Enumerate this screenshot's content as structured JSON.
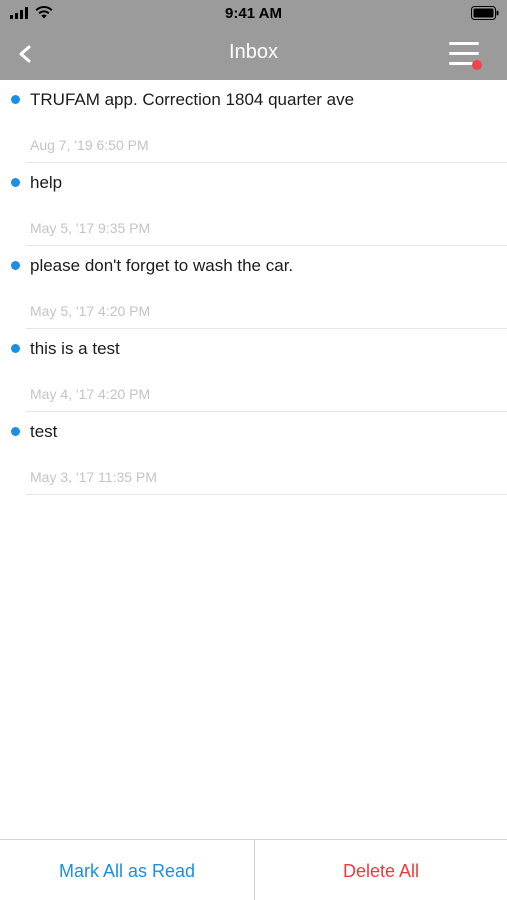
{
  "status_bar": {
    "time": "9:41 AM"
  },
  "nav": {
    "title": "Inbox",
    "back_icon": "chevron-left-icon",
    "menu_icon": "hamburger-menu-icon",
    "menu_badge_color": "#f0444a"
  },
  "messages": [
    {
      "text": "TRUFAM app. Correction 1804 quarter ave",
      "date": "Aug 7, '19 6:50 PM",
      "unread": true
    },
    {
      "text": "help",
      "date": "May 5, '17 9:35 PM",
      "unread": true
    },
    {
      "text": "please don't forget to wash the car.",
      "date": "May 5, '17 4:20 PM",
      "unread": true
    },
    {
      "text": "this is a test",
      "date": "May 4, '17 4:20 PM",
      "unread": true
    },
    {
      "text": "test",
      "date": "May 3, '17 11:35 PM",
      "unread": true
    }
  ],
  "actions": {
    "mark_all_read": "Mark All as Read",
    "delete_all": "Delete All"
  },
  "colors": {
    "header": "#9b9b9b",
    "accent": "#1a8fe3",
    "danger": "#ee3b3b"
  }
}
